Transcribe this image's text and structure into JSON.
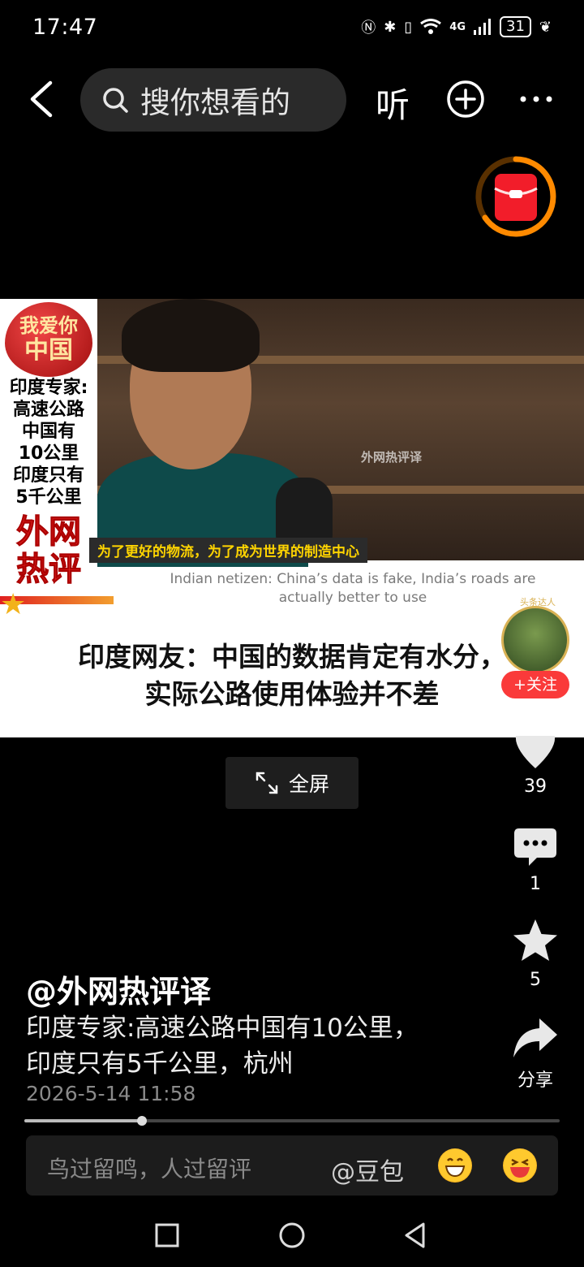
{
  "status_bar": {
    "time": "17:47",
    "network": "4G",
    "battery": "31"
  },
  "top_bar": {
    "search_placeholder": "搜你想看的",
    "listen_label": "听"
  },
  "video": {
    "left_banner": {
      "heart_text": [
        "我爱你",
        "中国"
      ],
      "lines": [
        "印度专家:",
        "高速公路",
        "中国有",
        "10公里",
        "印度只有",
        "5千公里"
      ],
      "red_title": [
        "外网",
        "热评"
      ]
    },
    "watermark": "外网热评译",
    "subtitle_cn": "为了更好的物流，为了成为世界的制造中心",
    "caption_en_line1": "Indian netizen: China’s data is fake, India’s roads are",
    "caption_en_line2": "actually better to use",
    "headline_line1": "印度网友：中国的数据肯定有水分，",
    "headline_line2": "实际公路使用体验并不差",
    "avatar_badge": "头条达人",
    "follow_label": "+关注"
  },
  "fullscreen_label": "全屏",
  "actions": {
    "likes": "39",
    "comments": "1",
    "favorites": "5",
    "share_label": "分享"
  },
  "post": {
    "author": "@外网热评译",
    "desc_line1": "印度专家:高速公路中国有10公里，",
    "desc_line2": "印度只有5千公里，杭州",
    "date": "2026-5-14 11:58",
    "progress": 0.22
  },
  "comment_bar": {
    "placeholder": "鸟过留鸣，人过留评",
    "mention": "@豆包"
  }
}
